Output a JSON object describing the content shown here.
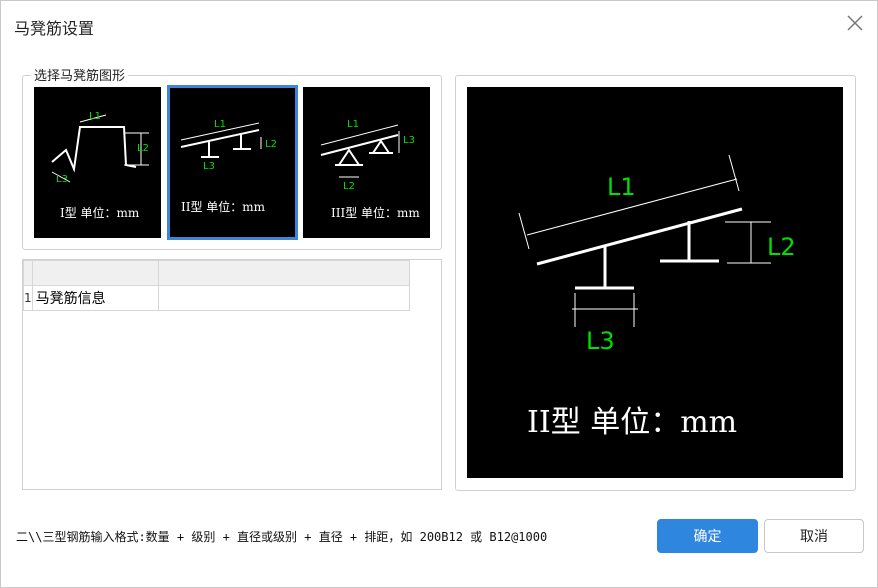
{
  "dialog": {
    "title": "马凳筋设置",
    "close_icon": "close-icon"
  },
  "shape_group": {
    "label": "选择马凳筋图形",
    "thumbnails": [
      {
        "id": "type1",
        "caption": "I型 单位：mm",
        "labels": [
          "L1",
          "L2",
          "L3"
        ],
        "selected": false
      },
      {
        "id": "type2",
        "caption": "II型 单位：mm",
        "labels": [
          "L1",
          "L2",
          "L3"
        ],
        "selected": true
      },
      {
        "id": "type3",
        "caption": "III型 单位：mm",
        "labels": [
          "L1",
          "L3",
          "L2"
        ],
        "selected": false
      }
    ]
  },
  "grid": {
    "rows": [
      {
        "index": "1",
        "name": "马凳筋信息",
        "value": ""
      }
    ]
  },
  "preview": {
    "caption": "II型 单位：mm",
    "labels": {
      "l1": "L1",
      "l2": "L2",
      "l3": "L3"
    }
  },
  "footer": {
    "hint": "二\\\\三型钢筋输入格式:数量 + 级别 + 直径或级别 + 直径 + 排距，如 200B12 或 B12@1000",
    "ok_label": "确定",
    "cancel_label": "取消"
  },
  "colors": {
    "accent": "#2f86df",
    "label_green": "#00e000",
    "drawing_white": "#ffffff",
    "canvas": "#000000"
  }
}
